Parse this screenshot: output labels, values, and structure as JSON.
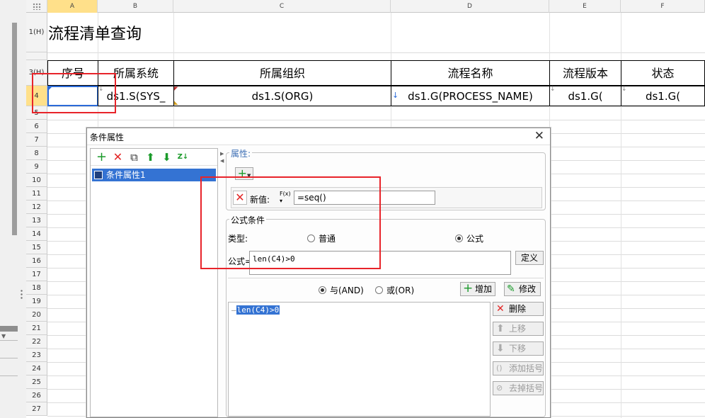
{
  "sheet": {
    "columns": [
      "A",
      "B",
      "C",
      "D",
      "E",
      "F"
    ],
    "rows": [
      "1(H)",
      "",
      "3(H)",
      "4",
      "5",
      "6",
      "7",
      "8",
      "9",
      "10",
      "11",
      "12",
      "13",
      "14",
      "15",
      "16",
      "17",
      "18",
      "19",
      "20",
      "21",
      "22",
      "23",
      "24",
      "25",
      "26",
      "27"
    ],
    "title": "流程清单查询",
    "header_cells": [
      "序号",
      "所属系统",
      "所属组织",
      "流程名称",
      "流程版本",
      "状态"
    ],
    "data_cells": [
      "",
      "ds1.S(SYS_",
      "ds1.S(ORG)",
      "ds1.G(PROCESS_NAME)",
      "ds1.G(",
      "ds1.G("
    ],
    "colors": {
      "selection": "#2a6ad8",
      "annotation_box": "#e8242a",
      "selected_header": "#ffe08a"
    }
  },
  "dialog": {
    "title": "条件属性",
    "close_symbol": "✕",
    "toolbar_icons": [
      "add-icon",
      "delete-icon",
      "copy-icon",
      "move-up-icon",
      "move-down-icon",
      "sort-icon"
    ],
    "tree": {
      "item": "条件属性1"
    },
    "properties": {
      "legend": "属性:",
      "new_value_label": "新值:",
      "fx_label": "F(x)",
      "new_value": "=seq()"
    },
    "formula_condition": {
      "legend": "公式条件",
      "type_label": "类型:",
      "option_normal": "普通",
      "option_formula": "公式",
      "formula_label": "公式=",
      "formula_value": "len(C4)>0",
      "define_button": "定义",
      "and_label": "与(AND)",
      "or_label": "或(OR)",
      "add_button": "增加",
      "modify_button": "修改",
      "condition_item": "len(C4)>0",
      "delete_button": "删除",
      "up_button": "上移",
      "down_button": "下移",
      "add_bracket_button": "添加括号",
      "remove_bracket_button": "去掉括号"
    }
  }
}
